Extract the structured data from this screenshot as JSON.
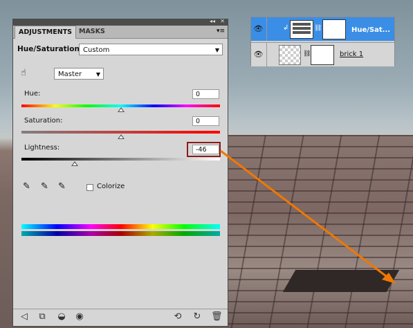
{
  "adjustments": {
    "tab_adjustments": "ADJUSTMENTS",
    "tab_masks": "MASKS",
    "title": "Hue/Saturation",
    "preset": "Custom",
    "channel": "Master",
    "hue_label": "Hue:",
    "hue_value": "0",
    "saturation_label": "Saturation:",
    "saturation_value": "0",
    "lightness_label": "Lightness:",
    "lightness_value": "-46",
    "colorize_label": "Colorize",
    "sliders": {
      "hue": 0,
      "saturation": 0,
      "lightness": -46
    }
  },
  "layers": [
    {
      "name": "Hue/Sat...",
      "selected": true
    },
    {
      "name": "brick 1",
      "selected": false
    }
  ],
  "colors": {
    "highlight_box": "#8b1a1a",
    "annotation_arrow": "#f07800",
    "layer_selected": "#3b8ee6"
  }
}
